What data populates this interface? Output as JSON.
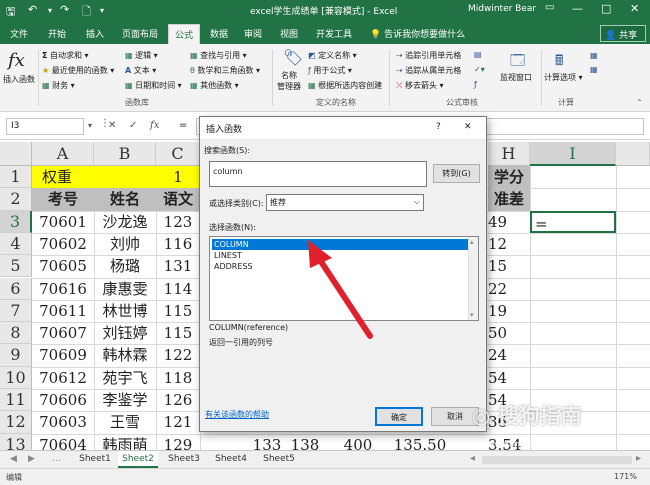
{
  "titlebar": {
    "title": "excel学生成绩单  [兼容模式]  -  Excel",
    "user": "Midwinter Bear",
    "min": "—",
    "max": "□",
    "close": "✕"
  },
  "tabs": [
    "文件",
    "开始",
    "插入",
    "页面布局",
    "公式",
    "数据",
    "审阅",
    "视图",
    "开发工具"
  ],
  "tell_me": "告诉我你想要做什么",
  "share": "共享",
  "ribbon": {
    "insert_function": "插入函数",
    "autosum": "自动求和",
    "recent": "最近使用的函数",
    "financial": "财务",
    "logical": "逻辑",
    "text": "文本",
    "datetime": "日期和时间",
    "lookup": "查找与引用",
    "mathtrig": "数学和三角函数",
    "more": "其他函数",
    "library_group": "函数库",
    "name_manager": "名称\n管理器",
    "define_name": "定义名称",
    "use_in_formula": "用于公式",
    "create_from_sel": "根据所选内容创建",
    "names_group": "定义的名称",
    "trace_precedents": "追踪引用单元格",
    "trace_dependents": "追踪从属单元格",
    "remove_arrows": "移去箭头",
    "audit_group": "公式审核",
    "watch_window": "监视窗口",
    "calc_options": "计算选项",
    "calc_group": "计算"
  },
  "formula_bar": {
    "name_box": "I3",
    "cancel": "✕",
    "enter": "✓",
    "fx": "fx",
    "eq": "="
  },
  "columns": [
    "A",
    "B",
    "C",
    "H",
    "I"
  ],
  "rows": [
    {
      "num": "1",
      "a": "权重",
      "b": "",
      "c": "1",
      "h": "学分",
      "i": ""
    },
    {
      "num": "2",
      "a": "考号",
      "b": "姓名",
      "c": "语文",
      "h": "准差",
      "i": ""
    },
    {
      "num": "3",
      "a": "70601",
      "b": "沙龙逸",
      "c": "123",
      "h": "49",
      "i": "="
    },
    {
      "num": "4",
      "a": "70602",
      "b": "刘帅",
      "c": "116",
      "h": "12",
      "i": ""
    },
    {
      "num": "5",
      "a": "70605",
      "b": "杨璐",
      "c": "131",
      "h": "15",
      "i": ""
    },
    {
      "num": "6",
      "a": "70616",
      "b": "康惠雯",
      "c": "114",
      "h": "22",
      "i": ""
    },
    {
      "num": "7",
      "a": "70611",
      "b": "林世博",
      "c": "115",
      "h": "19",
      "i": ""
    },
    {
      "num": "8",
      "a": "70607",
      "b": "刘钰婷",
      "c": "115",
      "h": "50",
      "i": ""
    },
    {
      "num": "9",
      "a": "70609",
      "b": "韩林霖",
      "c": "122",
      "h": "24",
      "i": ""
    },
    {
      "num": "10",
      "a": "70612",
      "b": "苑宇飞",
      "c": "118",
      "h": "54",
      "i": ""
    },
    {
      "num": "11",
      "a": "70606",
      "b": "李鉴学",
      "c": "126",
      "h": "54",
      "i": ""
    },
    {
      "num": "12",
      "a": "70603",
      "b": "王雪",
      "c": "121",
      "h": "36",
      "i": ""
    },
    {
      "num": "13",
      "a": "70604",
      "b": "韩雨萌",
      "c": "129",
      "h": "3.54",
      "i": ""
    }
  ],
  "row13_extra": [
    "133",
    "138",
    "400",
    "135.50"
  ],
  "sheets": [
    "Sheet1",
    "Sheet2",
    "Sheet3",
    "Sheet4",
    "Sheet5"
  ],
  "status": {
    "mode": "编辑",
    "zoom": "171%"
  },
  "dialog": {
    "title": "插入函数",
    "help": "?",
    "close": "✕",
    "search_label": "搜索函数(S):",
    "search_value": "column",
    "go_button": "转到(G)",
    "category_label": "或选择类别(C):",
    "category_value": "推荐",
    "select_label": "选择函数(N):",
    "functions": [
      "COLUMN",
      "LINEST",
      "ADDRESS"
    ],
    "signature": "COLUMN(reference)",
    "description": "返回一引用的列号",
    "help_link": "有关该函数的帮助",
    "ok": "确定",
    "cancel": "取消"
  },
  "watermark": {
    "brand": "搜狗指南",
    "url": "zhinan.sogou.com"
  },
  "colors": {
    "excel_green": "#217346",
    "highlight_yellow": "#ffff00",
    "header_gray": "#bfbfbf",
    "arrow_red": "#e0202a",
    "select_blue": "#0078d7"
  }
}
